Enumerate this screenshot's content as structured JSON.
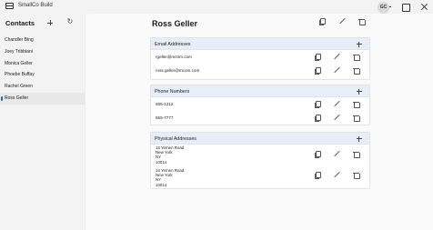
{
  "window": {
    "title": "SmallCo Build"
  },
  "sidebar": {
    "title": "Contacts",
    "contacts": [
      "Chandler Bing",
      "Joey Tribbiani",
      "Monica Geller",
      "Phoebe Buffay",
      "Rachel Green",
      "Ross Geller"
    ],
    "selected": "Ross Geller",
    "accent_color": "#2e63c8"
  },
  "user": {
    "initials": "GC"
  },
  "detail": {
    "name": "Ross Geller",
    "sections": {
      "email": {
        "title": "Email Addresses",
        "items": [
          "rgeller@mcom.com",
          "ross.geller@mcom.com"
        ]
      },
      "phone": {
        "title": "Phone Numbers",
        "items": [
          "555-1212",
          "555-7777"
        ]
      },
      "address": {
        "title": "Physical Addresses",
        "items": [
          [
            "15 Yemen Road",
            "New York",
            "NY",
            "10014"
          ],
          [
            "16 Yemen Road",
            "New York",
            "NY",
            "10014"
          ]
        ]
      }
    },
    "header_color": "#e8eef7"
  },
  "icons": [
    "window-icon",
    "add-icon",
    "refresh-icon",
    "copy-icon",
    "edit-icon",
    "delete-icon"
  ]
}
